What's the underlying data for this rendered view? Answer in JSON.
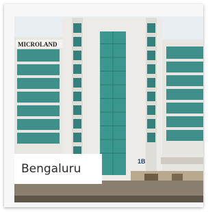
{
  "card": {
    "location_label": "Bengaluru"
  },
  "photo": {
    "signage_text": "MICROLAND",
    "building_number": "1B"
  },
  "colors": {
    "glass": "#3e9a92",
    "glass_dark": "#2c7a74",
    "facade": "#e9e7e2",
    "sky": "#dfe7ee",
    "label_bg": "#ffffff",
    "label_text": "#2b2b2b"
  }
}
